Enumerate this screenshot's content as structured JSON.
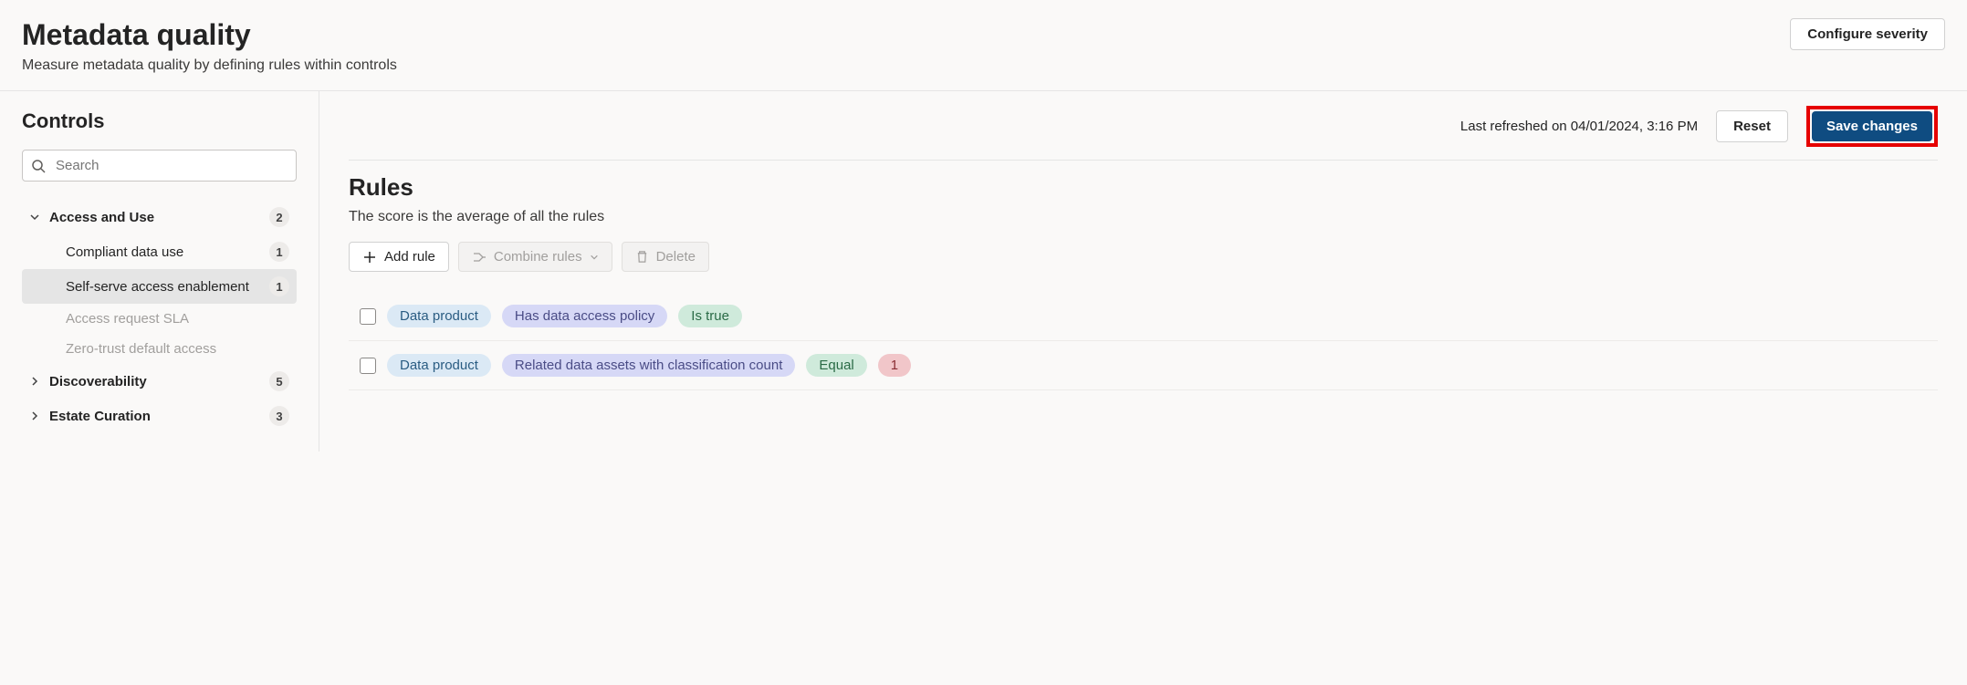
{
  "header": {
    "title": "Metadata quality",
    "subtitle": "Measure metadata quality by defining rules within controls",
    "configure": "Configure severity"
  },
  "sidebar": {
    "title": "Controls",
    "search_placeholder": "Search",
    "groups": [
      {
        "label": "Access and Use",
        "count": "2",
        "expanded": true,
        "items": [
          {
            "label": "Compliant data use",
            "count": "1",
            "selected": false,
            "disabled": false
          },
          {
            "label": "Self-serve access enablement",
            "count": "1",
            "selected": true,
            "disabled": false
          },
          {
            "label": "Access request SLA",
            "count": "",
            "selected": false,
            "disabled": true
          },
          {
            "label": "Zero-trust default access",
            "count": "",
            "selected": false,
            "disabled": true
          }
        ]
      },
      {
        "label": "Discoverability",
        "count": "5",
        "expanded": false,
        "items": []
      },
      {
        "label": "Estate Curation",
        "count": "3",
        "expanded": false,
        "items": []
      }
    ]
  },
  "topbar": {
    "refreshed": "Last refreshed on 04/01/2024, 3:16 PM",
    "reset": "Reset",
    "save": "Save changes"
  },
  "rules": {
    "title": "Rules",
    "desc": "The score is the average of all the rules",
    "add": "Add rule",
    "combine": "Combine rules",
    "delete": "Delete",
    "rows": [
      {
        "entity": "Data product",
        "attribute": "Has data access policy",
        "condition": "Is true",
        "value": ""
      },
      {
        "entity": "Data product",
        "attribute": "Related data assets with classification count",
        "condition": "Equal",
        "value": "1"
      }
    ]
  }
}
